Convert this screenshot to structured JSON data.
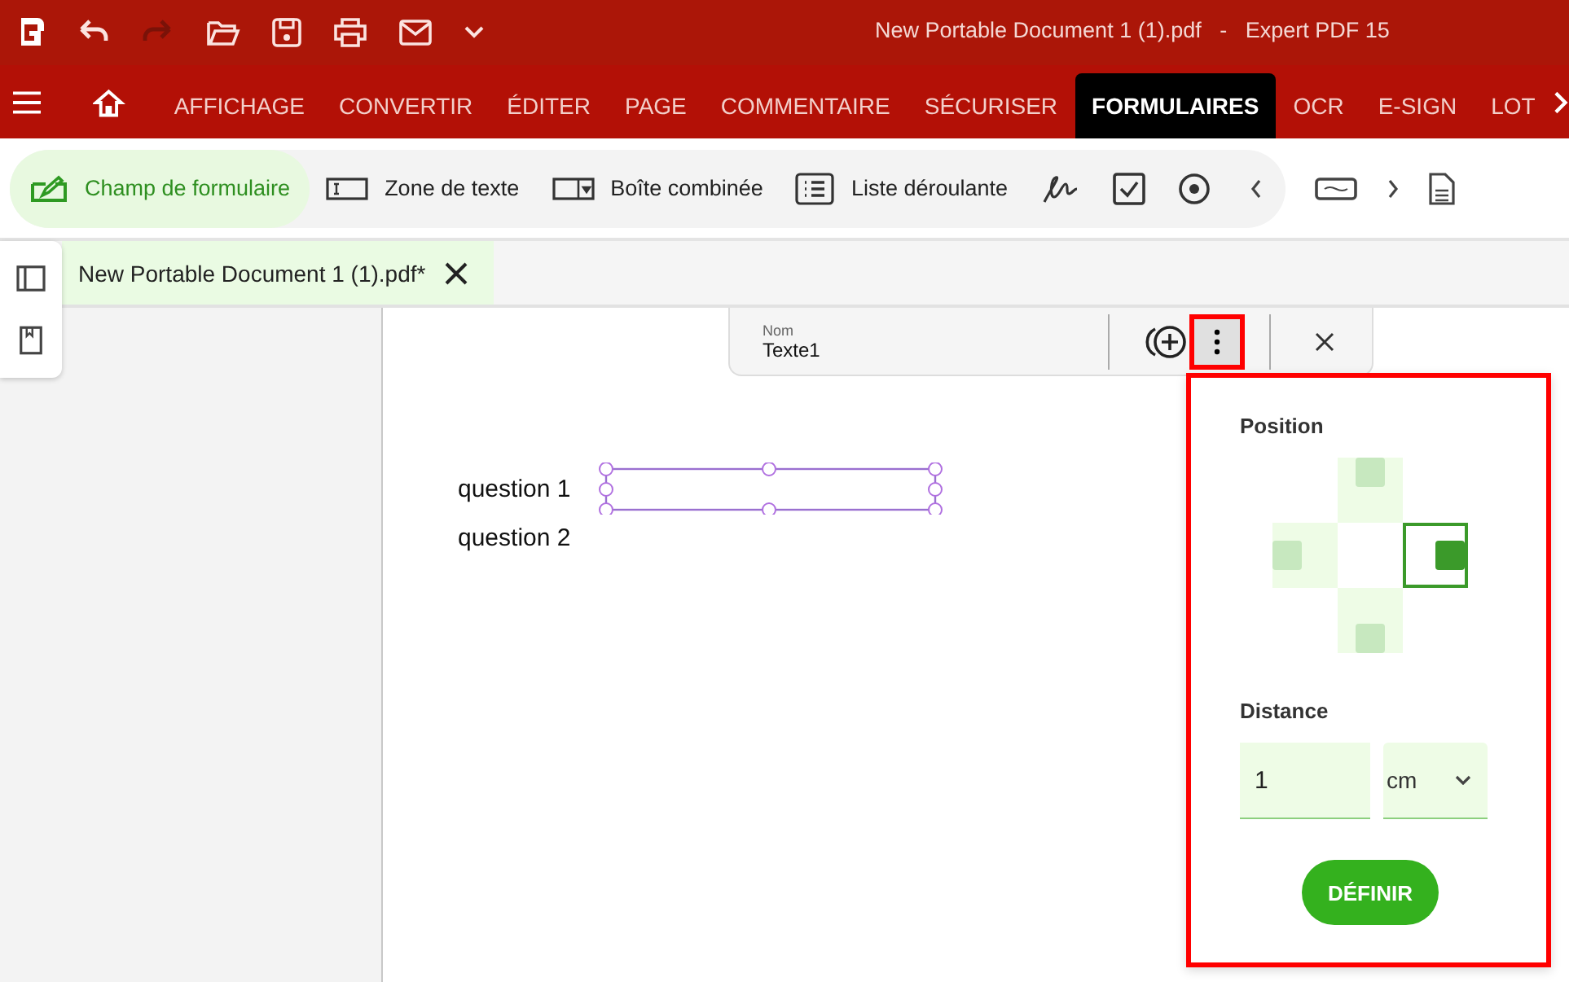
{
  "title_bar": {
    "title": "New Portable Document 1 (1).pdf   -   Expert PDF 15",
    "quick_access": [
      {
        "kind": "undo",
        "disabled": false
      },
      {
        "kind": "redo",
        "disabled": true
      },
      {
        "kind": "open",
        "disabled": false
      },
      {
        "kind": "save",
        "disabled": false
      },
      {
        "kind": "print",
        "disabled": false
      },
      {
        "kind": "mail",
        "disabled": false
      },
      {
        "kind": "more",
        "disabled": false
      }
    ]
  },
  "ribbon_tabs": [
    {
      "label": "AFFICHAGE",
      "selected": false
    },
    {
      "label": "CONVERTIR",
      "selected": false
    },
    {
      "label": "ÉDITER",
      "selected": false
    },
    {
      "label": "PAGE",
      "selected": false
    },
    {
      "label": "COMMENTAIRE",
      "selected": false
    },
    {
      "label": "SÉCURISER",
      "selected": false
    },
    {
      "label": "FORMULAIRES",
      "selected": true
    },
    {
      "label": "OCR",
      "selected": false
    },
    {
      "label": "E-SIGN",
      "selected": false
    },
    {
      "label": "LOT",
      "selected": false
    }
  ],
  "toolbar": {
    "items": [
      {
        "kind": "form-field",
        "label": "Champ de formulaire",
        "selected": true
      },
      {
        "kind": "text-box",
        "label": "Zone de texte",
        "selected": false
      },
      {
        "kind": "combo-box",
        "label": "Boîte combinée",
        "selected": false
      },
      {
        "kind": "list-box",
        "label": "Liste déroulante",
        "selected": false
      },
      {
        "kind": "signature",
        "selected": false
      },
      {
        "kind": "checkbox",
        "selected": false
      },
      {
        "kind": "radio",
        "selected": false
      }
    ],
    "extra": [
      {
        "kind": "button"
      },
      {
        "kind": "document"
      }
    ]
  },
  "document_tab": {
    "label": "New Portable Document 1 (1).pdf*"
  },
  "document": {
    "lines": [
      {
        "label": "question 1"
      },
      {
        "label": "question 2"
      }
    ]
  },
  "field_toolbar": {
    "name_label": "Nom",
    "name_value": "Texte1"
  },
  "position_panel": {
    "title": "Position",
    "positions": [
      {
        "kind": "top",
        "selected": false
      },
      {
        "kind": "left",
        "selected": false
      },
      {
        "kind": "right",
        "selected": true
      },
      {
        "kind": "bottom",
        "selected": false
      }
    ],
    "distance_label": "Distance",
    "distance_value": "1",
    "unit": "cm",
    "button": "DÉFINIR"
  }
}
